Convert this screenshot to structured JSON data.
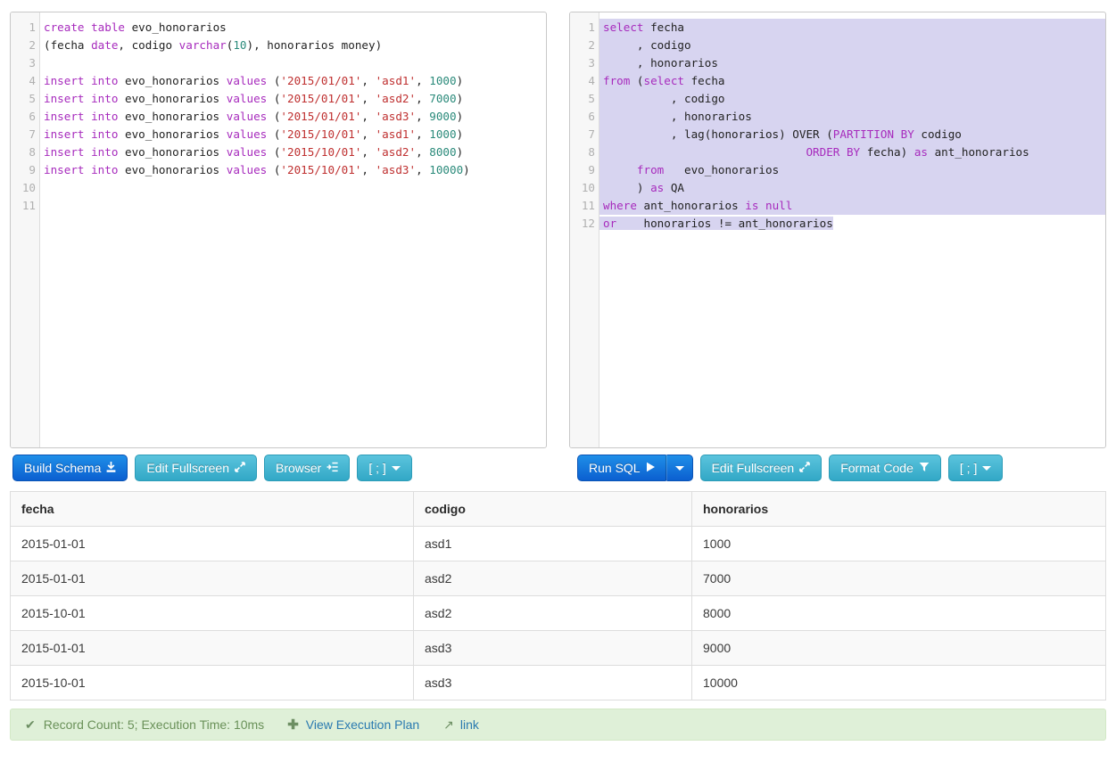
{
  "schema_editor": {
    "name": "schema-sql-editor",
    "line_count": 11,
    "lines": [
      [
        {
          "t": "k",
          "v": "create table"
        },
        {
          "t": "t",
          "v": " evo_honorarios"
        }
      ],
      [
        {
          "t": "t",
          "v": "(fecha "
        },
        {
          "t": "k",
          "v": "date"
        },
        {
          "t": "t",
          "v": ", codigo "
        },
        {
          "t": "k",
          "v": "varchar"
        },
        {
          "t": "t",
          "v": "("
        },
        {
          "t": "n",
          "v": "10"
        },
        {
          "t": "t",
          "v": "), honorarios money)"
        }
      ],
      [],
      [
        {
          "t": "k",
          "v": "insert into"
        },
        {
          "t": "t",
          "v": " evo_honorarios "
        },
        {
          "t": "k",
          "v": "values"
        },
        {
          "t": "t",
          "v": " ("
        },
        {
          "t": "s",
          "v": "'2015/01/01'"
        },
        {
          "t": "t",
          "v": ", "
        },
        {
          "t": "s",
          "v": "'asd1'"
        },
        {
          "t": "t",
          "v": ", "
        },
        {
          "t": "n",
          "v": "1000"
        },
        {
          "t": "t",
          "v": ")"
        }
      ],
      [
        {
          "t": "k",
          "v": "insert into"
        },
        {
          "t": "t",
          "v": " evo_honorarios "
        },
        {
          "t": "k",
          "v": "values"
        },
        {
          "t": "t",
          "v": " ("
        },
        {
          "t": "s",
          "v": "'2015/01/01'"
        },
        {
          "t": "t",
          "v": ", "
        },
        {
          "t": "s",
          "v": "'asd2'"
        },
        {
          "t": "t",
          "v": ", "
        },
        {
          "t": "n",
          "v": "7000"
        },
        {
          "t": "t",
          "v": ")"
        }
      ],
      [
        {
          "t": "k",
          "v": "insert into"
        },
        {
          "t": "t",
          "v": " evo_honorarios "
        },
        {
          "t": "k",
          "v": "values"
        },
        {
          "t": "t",
          "v": " ("
        },
        {
          "t": "s",
          "v": "'2015/01/01'"
        },
        {
          "t": "t",
          "v": ", "
        },
        {
          "t": "s",
          "v": "'asd3'"
        },
        {
          "t": "t",
          "v": ", "
        },
        {
          "t": "n",
          "v": "9000"
        },
        {
          "t": "t",
          "v": ")"
        }
      ],
      [
        {
          "t": "k",
          "v": "insert into"
        },
        {
          "t": "t",
          "v": " evo_honorarios "
        },
        {
          "t": "k",
          "v": "values"
        },
        {
          "t": "t",
          "v": " ("
        },
        {
          "t": "s",
          "v": "'2015/10/01'"
        },
        {
          "t": "t",
          "v": ", "
        },
        {
          "t": "s",
          "v": "'asd1'"
        },
        {
          "t": "t",
          "v": ", "
        },
        {
          "t": "n",
          "v": "1000"
        },
        {
          "t": "t",
          "v": ")"
        }
      ],
      [
        {
          "t": "k",
          "v": "insert into"
        },
        {
          "t": "t",
          "v": " evo_honorarios "
        },
        {
          "t": "k",
          "v": "values"
        },
        {
          "t": "t",
          "v": " ("
        },
        {
          "t": "s",
          "v": "'2015/10/01'"
        },
        {
          "t": "t",
          "v": ", "
        },
        {
          "t": "s",
          "v": "'asd2'"
        },
        {
          "t": "t",
          "v": ", "
        },
        {
          "t": "n",
          "v": "8000"
        },
        {
          "t": "t",
          "v": ")"
        }
      ],
      [
        {
          "t": "k",
          "v": "insert into"
        },
        {
          "t": "t",
          "v": " evo_honorarios "
        },
        {
          "t": "k",
          "v": "values"
        },
        {
          "t": "t",
          "v": " ("
        },
        {
          "t": "s",
          "v": "'2015/10/01'"
        },
        {
          "t": "t",
          "v": ", "
        },
        {
          "t": "s",
          "v": "'asd3'"
        },
        {
          "t": "t",
          "v": ", "
        },
        {
          "t": "n",
          "v": "10000"
        },
        {
          "t": "t",
          "v": ")"
        }
      ],
      [],
      []
    ]
  },
  "query_editor": {
    "name": "query-sql-editor",
    "line_count": 12,
    "selection": {
      "full_lines": [
        1,
        2,
        3,
        4,
        5,
        6,
        7,
        8,
        9,
        10,
        11
      ],
      "partial_last_line": 12
    },
    "lines": [
      {
        "sel": "full",
        "parts": [
          {
            "t": "k",
            "v": "select"
          },
          {
            "t": "t",
            "v": " fecha"
          }
        ]
      },
      {
        "sel": "full",
        "parts": [
          {
            "t": "t",
            "v": "     , codigo"
          }
        ]
      },
      {
        "sel": "full",
        "parts": [
          {
            "t": "t",
            "v": "     , honorarios"
          }
        ]
      },
      {
        "sel": "full",
        "parts": [
          {
            "t": "k",
            "v": "from"
          },
          {
            "t": "t",
            "v": " ("
          },
          {
            "t": "k",
            "v": "select"
          },
          {
            "t": "t",
            "v": " fecha"
          }
        ]
      },
      {
        "sel": "full",
        "parts": [
          {
            "t": "t",
            "v": "          , codigo"
          }
        ]
      },
      {
        "sel": "full",
        "parts": [
          {
            "t": "t",
            "v": "          , honorarios"
          }
        ]
      },
      {
        "sel": "full",
        "parts": [
          {
            "t": "t",
            "v": "          , lag(honorarios) OVER ("
          },
          {
            "t": "k",
            "v": "PARTITION BY"
          },
          {
            "t": "t",
            "v": " codigo"
          }
        ]
      },
      {
        "sel": "full",
        "parts": [
          {
            "t": "t",
            "v": "                              "
          },
          {
            "t": "k",
            "v": "ORDER BY"
          },
          {
            "t": "t",
            "v": " fecha) "
          },
          {
            "t": "k",
            "v": "as"
          },
          {
            "t": "t",
            "v": " ant_honorarios"
          }
        ]
      },
      {
        "sel": "full",
        "parts": [
          {
            "t": "t",
            "v": "     "
          },
          {
            "t": "k",
            "v": "from"
          },
          {
            "t": "t",
            "v": "   evo_honorarios"
          }
        ]
      },
      {
        "sel": "full",
        "parts": [
          {
            "t": "t",
            "v": "     ) "
          },
          {
            "t": "k",
            "v": "as"
          },
          {
            "t": "t",
            "v": " QA"
          }
        ]
      },
      {
        "sel": "full",
        "parts": [
          {
            "t": "k",
            "v": "where"
          },
          {
            "t": "t",
            "v": " ant_honorarios "
          },
          {
            "t": "k",
            "v": "is null"
          }
        ]
      },
      {
        "sel": "part",
        "parts": [
          {
            "t": "k",
            "v": "or"
          },
          {
            "t": "t",
            "v": "    honorarios != ant_honorarios"
          }
        ]
      }
    ]
  },
  "schema_toolbar": {
    "build_schema": {
      "label": "Build Schema",
      "icon": "download-icon",
      "glyph": "⤓"
    },
    "edit_fullscreen": {
      "label": "Edit Fullscreen",
      "icon": "expand-arrows-icon",
      "glyph": "↗"
    },
    "browser": {
      "label": "Browser",
      "icon": "indent-list-icon",
      "glyph": "⇥"
    },
    "separator": {
      "label": "[ ; ]",
      "icon": "chevron-down-icon"
    }
  },
  "query_toolbar": {
    "run_sql": {
      "label": "Run SQL",
      "icon": "play-icon",
      "glyph": "▶"
    },
    "run_sql_caret": {
      "icon": "chevron-down-icon"
    },
    "edit_fullscreen": {
      "label": "Edit Fullscreen",
      "icon": "expand-arrows-icon",
      "glyph": "↗"
    },
    "format_code": {
      "label": "Format Code",
      "icon": "filter-icon",
      "glyph": "▼"
    },
    "separator": {
      "label": "[ ; ]",
      "icon": "chevron-down-icon"
    }
  },
  "results_table": {
    "columns": [
      "fecha",
      "codigo",
      "honorarios"
    ],
    "rows": [
      [
        "2015-01-01",
        "asd1",
        "1000"
      ],
      [
        "2015-01-01",
        "asd2",
        "7000"
      ],
      [
        "2015-10-01",
        "asd2",
        "8000"
      ],
      [
        "2015-01-01",
        "asd3",
        "9000"
      ],
      [
        "2015-10-01",
        "asd3",
        "10000"
      ]
    ]
  },
  "status_bar": {
    "check_icon": "check-icon",
    "message": "Record Count: 5; Execution Time: 10ms",
    "plus_icon": "plus-icon",
    "execution_plan_link": "View Execution Plan",
    "arrow_icon": "share-arrow-icon",
    "share_link": "link"
  },
  "colors": {
    "primary_button": "#0b5fd0",
    "info_button": "#32a8c6",
    "selection": "#d7d4f0",
    "keyword": "#a72bbd",
    "string": "#bf3030",
    "number": "#2a8a7a",
    "status_bg": "#dff0d8",
    "status_text": "#6a9159",
    "link": "#2a7ab0"
  }
}
